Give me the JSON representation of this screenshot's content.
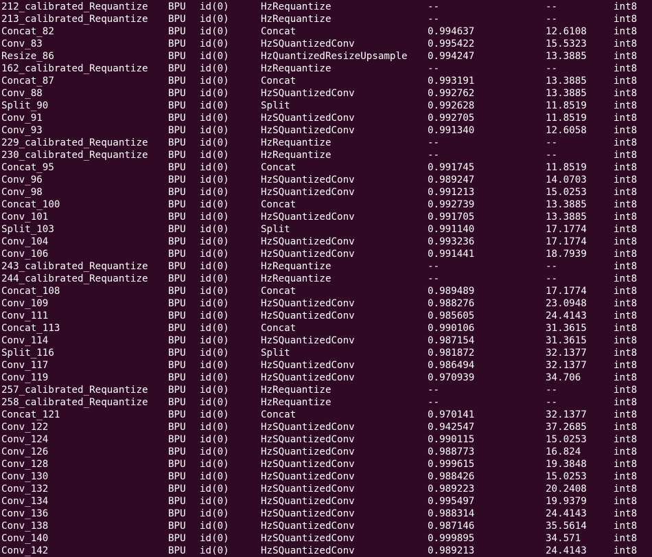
{
  "terminal": {
    "rows": [
      [
        "212_calibrated_Requantize",
        "BPU",
        "id(0)",
        "HzRequantize",
        "--",
        "--",
        "int8"
      ],
      [
        "213_calibrated_Requantize",
        "BPU",
        "id(0)",
        "HzRequantize",
        "--",
        "--",
        "int8"
      ],
      [
        "Concat_82",
        "BPU",
        "id(0)",
        "Concat",
        "0.994637",
        "12.6108",
        "int8"
      ],
      [
        "Conv_83",
        "BPU",
        "id(0)",
        "HzSQuantizedConv",
        "0.995422",
        "15.5323",
        "int8"
      ],
      [
        "Resize_86",
        "BPU",
        "id(0)",
        "HzQuantizedResizeUpsample",
        "0.994247",
        "13.3885",
        "int8"
      ],
      [
        "162_calibrated_Requantize",
        "BPU",
        "id(0)",
        "HzRequantize",
        "--",
        "--",
        "int8"
      ],
      [
        "Concat_87",
        "BPU",
        "id(0)",
        "Concat",
        "0.993191",
        "13.3885",
        "int8"
      ],
      [
        "Conv_88",
        "BPU",
        "id(0)",
        "HzSQuantizedConv",
        "0.992762",
        "13.3885",
        "int8"
      ],
      [
        "Split_90",
        "BPU",
        "id(0)",
        "Split",
        "0.992628",
        "11.8519",
        "int8"
      ],
      [
        "Conv_91",
        "BPU",
        "id(0)",
        "HzSQuantizedConv",
        "0.992705",
        "11.8519",
        "int8"
      ],
      [
        "Conv_93",
        "BPU",
        "id(0)",
        "HzSQuantizedConv",
        "0.991340",
        "12.6058",
        "int8"
      ],
      [
        "229_calibrated_Requantize",
        "BPU",
        "id(0)",
        "HzRequantize",
        "--",
        "--",
        "int8"
      ],
      [
        "230_calibrated_Requantize",
        "BPU",
        "id(0)",
        "HzRequantize",
        "--",
        "--",
        "int8"
      ],
      [
        "Concat_95",
        "BPU",
        "id(0)",
        "Concat",
        "0.991745",
        "11.8519",
        "int8"
      ],
      [
        "Conv_96",
        "BPU",
        "id(0)",
        "HzSQuantizedConv",
        "0.989247",
        "14.0703",
        "int8"
      ],
      [
        "Conv_98",
        "BPU",
        "id(0)",
        "HzSQuantizedConv",
        "0.991213",
        "15.0253",
        "int8"
      ],
      [
        "Concat_100",
        "BPU",
        "id(0)",
        "Concat",
        "0.992739",
        "13.3885",
        "int8"
      ],
      [
        "Conv_101",
        "BPU",
        "id(0)",
        "HzSQuantizedConv",
        "0.991705",
        "13.3885",
        "int8"
      ],
      [
        "Split_103",
        "BPU",
        "id(0)",
        "Split",
        "0.991140",
        "17.1774",
        "int8"
      ],
      [
        "Conv_104",
        "BPU",
        "id(0)",
        "HzSQuantizedConv",
        "0.993236",
        "17.1774",
        "int8"
      ],
      [
        "Conv_106",
        "BPU",
        "id(0)",
        "HzSQuantizedConv",
        "0.991441",
        "18.7939",
        "int8"
      ],
      [
        "243_calibrated_Requantize",
        "BPU",
        "id(0)",
        "HzRequantize",
        "--",
        "--",
        "int8"
      ],
      [
        "244_calibrated_Requantize",
        "BPU",
        "id(0)",
        "HzRequantize",
        "--",
        "--",
        "int8"
      ],
      [
        "Concat_108",
        "BPU",
        "id(0)",
        "Concat",
        "0.989489",
        "17.1774",
        "int8"
      ],
      [
        "Conv_109",
        "BPU",
        "id(0)",
        "HzSQuantizedConv",
        "0.988276",
        "23.0948",
        "int8"
      ],
      [
        "Conv_111",
        "BPU",
        "id(0)",
        "HzSQuantizedConv",
        "0.985605",
        "24.4143",
        "int8"
      ],
      [
        "Concat_113",
        "BPU",
        "id(0)",
        "Concat",
        "0.990106",
        "31.3615",
        "int8"
      ],
      [
        "Conv_114",
        "BPU",
        "id(0)",
        "HzSQuantizedConv",
        "0.987154",
        "31.3615",
        "int8"
      ],
      [
        "Split_116",
        "BPU",
        "id(0)",
        "Split",
        "0.981872",
        "32.1377",
        "int8"
      ],
      [
        "Conv_117",
        "BPU",
        "id(0)",
        "HzSQuantizedConv",
        "0.986494",
        "32.1377",
        "int8"
      ],
      [
        "Conv_119",
        "BPU",
        "id(0)",
        "HzSQuantizedConv",
        "0.970939",
        "34.706",
        "int8"
      ],
      [
        "257_calibrated_Requantize",
        "BPU",
        "id(0)",
        "HzRequantize",
        "--",
        "--",
        "int8"
      ],
      [
        "258_calibrated_Requantize",
        "BPU",
        "id(0)",
        "HzRequantize",
        "--",
        "--",
        "int8"
      ],
      [
        "Concat_121",
        "BPU",
        "id(0)",
        "Concat",
        "0.970141",
        "32.1377",
        "int8"
      ],
      [
        "Conv_122",
        "BPU",
        "id(0)",
        "HzSQuantizedConv",
        "0.942547",
        "37.2685",
        "int8"
      ],
      [
        "Conv_124",
        "BPU",
        "id(0)",
        "HzSQuantizedConv",
        "0.990115",
        "15.0253",
        "int8"
      ],
      [
        "Conv_126",
        "BPU",
        "id(0)",
        "HzSQuantizedConv",
        "0.988773",
        "16.824",
        "int8"
      ],
      [
        "Conv_128",
        "BPU",
        "id(0)",
        "HzSQuantizedConv",
        "0.999615",
        "19.3848",
        "int8"
      ],
      [
        "Conv_130",
        "BPU",
        "id(0)",
        "HzSQuantizedConv",
        "0.988426",
        "15.0253",
        "int8"
      ],
      [
        "Conv_132",
        "BPU",
        "id(0)",
        "HzSQuantizedConv",
        "0.989223",
        "20.2408",
        "int8"
      ],
      [
        "Conv_134",
        "BPU",
        "id(0)",
        "HzSQuantizedConv",
        "0.995497",
        "19.9379",
        "int8"
      ],
      [
        "Conv_136",
        "BPU",
        "id(0)",
        "HzSQuantizedConv",
        "0.988314",
        "24.4143",
        "int8"
      ],
      [
        "Conv_138",
        "BPU",
        "id(0)",
        "HzSQuantizedConv",
        "0.987146",
        "35.5614",
        "int8"
      ],
      [
        "Conv_140",
        "BPU",
        "id(0)",
        "HzSQuantizedConv",
        "0.999895",
        "34.571",
        "int8"
      ],
      [
        "Conv_142",
        "BPU",
        "id(0)",
        "HzSQuantizedConv",
        "0.989213",
        "24.4143",
        "int8"
      ]
    ]
  },
  "colors": {
    "background": "#300a24",
    "foreground": "#ffffff"
  }
}
